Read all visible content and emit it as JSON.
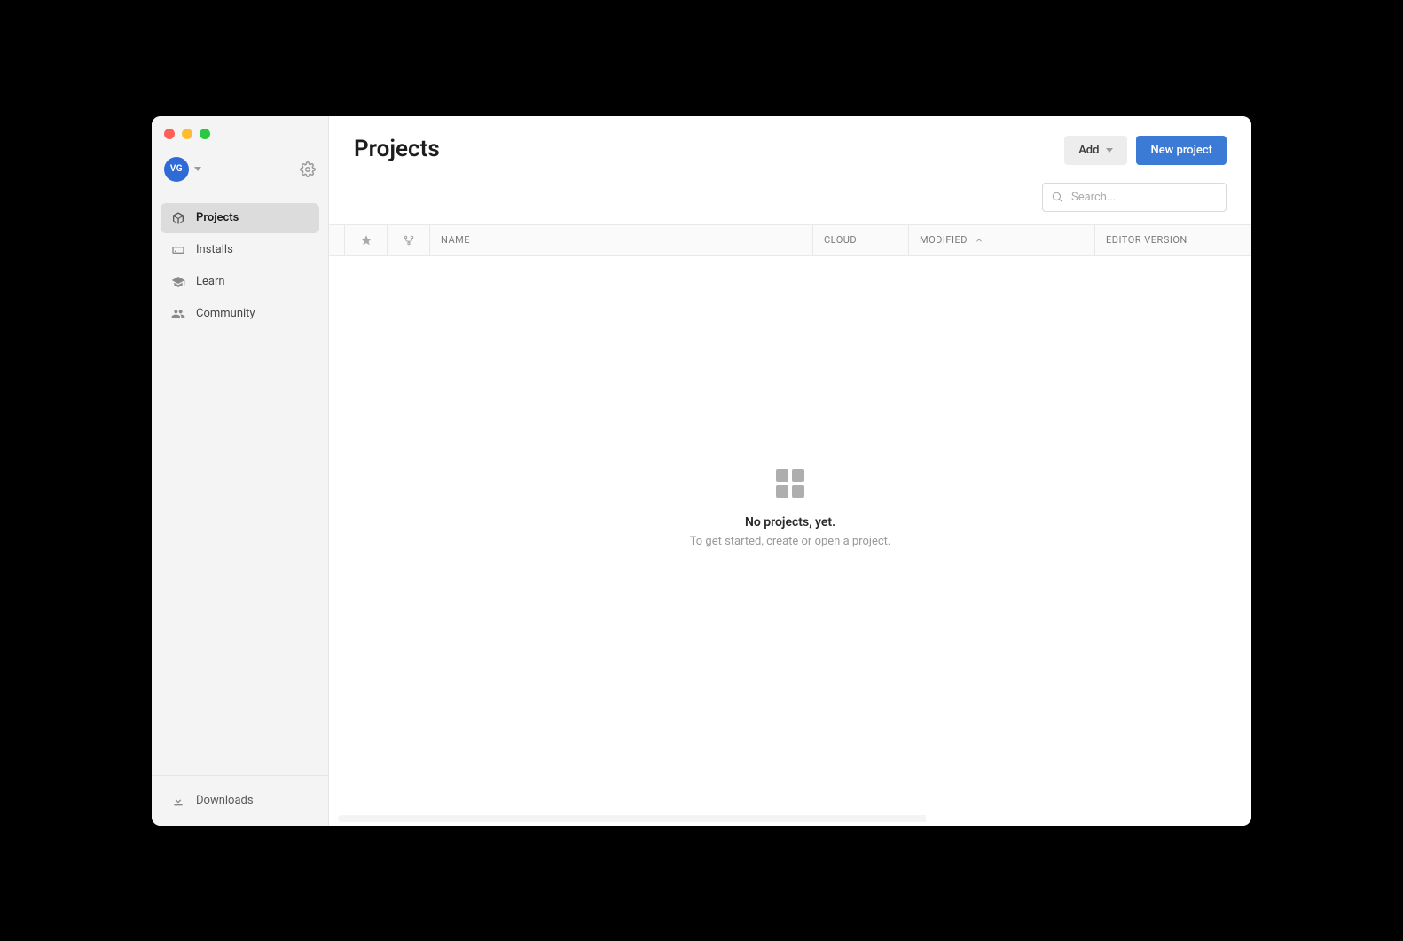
{
  "user": {
    "initials": "VG"
  },
  "sidebar": {
    "items": [
      {
        "label": "Projects"
      },
      {
        "label": "Installs"
      },
      {
        "label": "Learn"
      },
      {
        "label": "Community"
      }
    ],
    "footer": {
      "downloads_label": "Downloads"
    }
  },
  "header": {
    "title": "Projects",
    "add_label": "Add",
    "new_project_label": "New project"
  },
  "search": {
    "placeholder": "Search..."
  },
  "columns": {
    "name": "NAME",
    "cloud": "CLOUD",
    "modified": "MODIFIED",
    "editor_version": "EDITOR VERSION"
  },
  "empty": {
    "title": "No projects, yet.",
    "subtitle": "To get started, create or open a project."
  }
}
